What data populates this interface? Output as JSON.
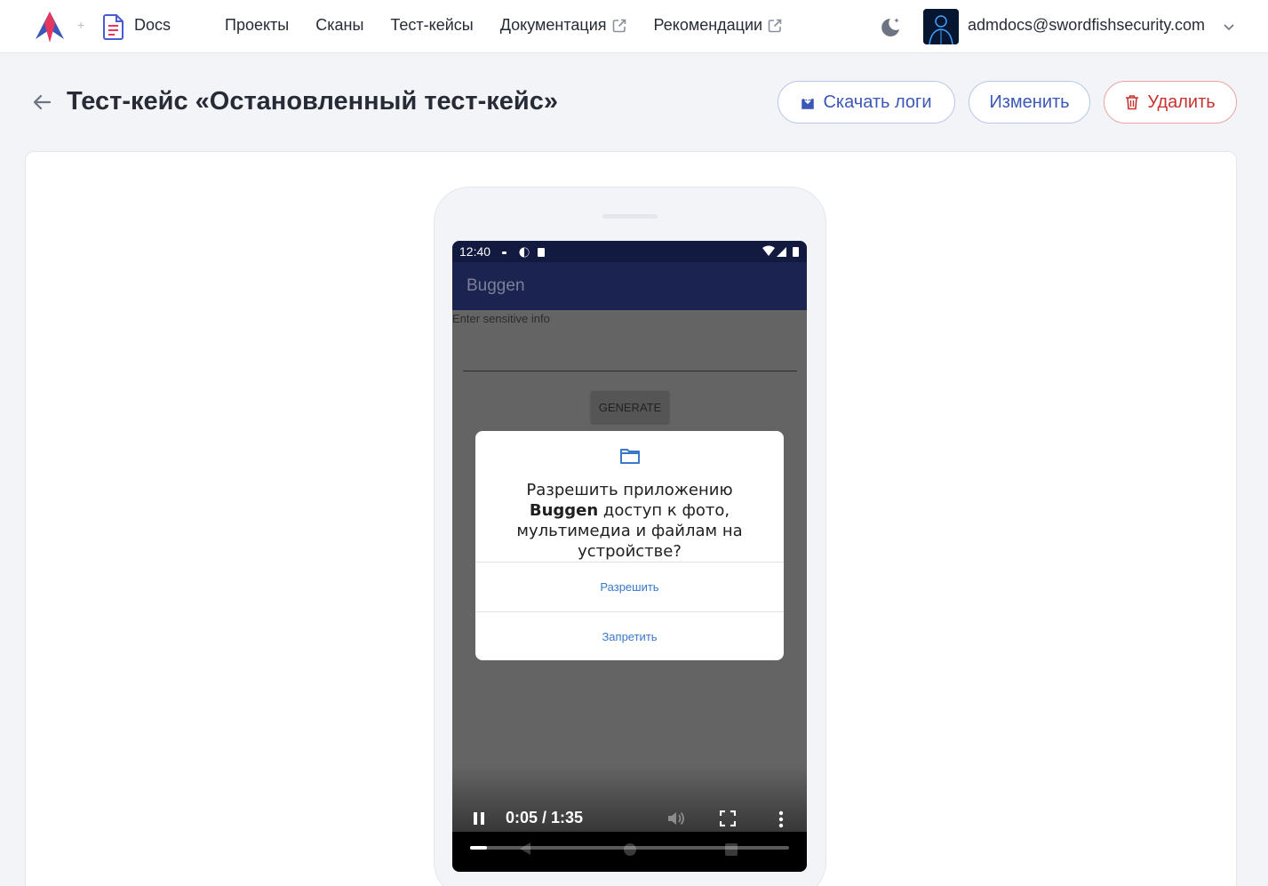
{
  "header": {
    "plus_sign": "+",
    "docs_label": "Docs",
    "nav": [
      {
        "label": "Проекты",
        "external": false
      },
      {
        "label": "Сканы",
        "external": false
      },
      {
        "label": "Тест-кейсы",
        "external": false
      },
      {
        "label": "Документация",
        "external": true
      },
      {
        "label": "Рекомендации",
        "external": true
      }
    ],
    "user_email": "admdocs@swordfishsecurity.com"
  },
  "page": {
    "title": "Тест-кейс «Остановленный тест-кейс»",
    "buttons": {
      "download_logs": "Скачать логи",
      "edit": "Изменить",
      "delete": "Удалить"
    }
  },
  "device": {
    "status_time": "12:40",
    "app_title": "Buggen",
    "field_label": "Enter sensitive info",
    "generate_button": "GENERATE",
    "dialog": {
      "text_before": "Разрешить приложению ",
      "app_name": "Buggen",
      "text_after": " доступ к фото, мультимедиа и файлам на устройстве?",
      "allow": "Разрешить",
      "deny": "Запретить"
    }
  },
  "video": {
    "time_display": "0:05 / 1:35",
    "progress_fraction": 0.0526
  },
  "colors": {
    "accent": "#3b57b8",
    "danger": "#c8322f",
    "app_bar": "#1b2350",
    "status_bar": "#121a40",
    "dialog_button": "#3a78c9"
  }
}
